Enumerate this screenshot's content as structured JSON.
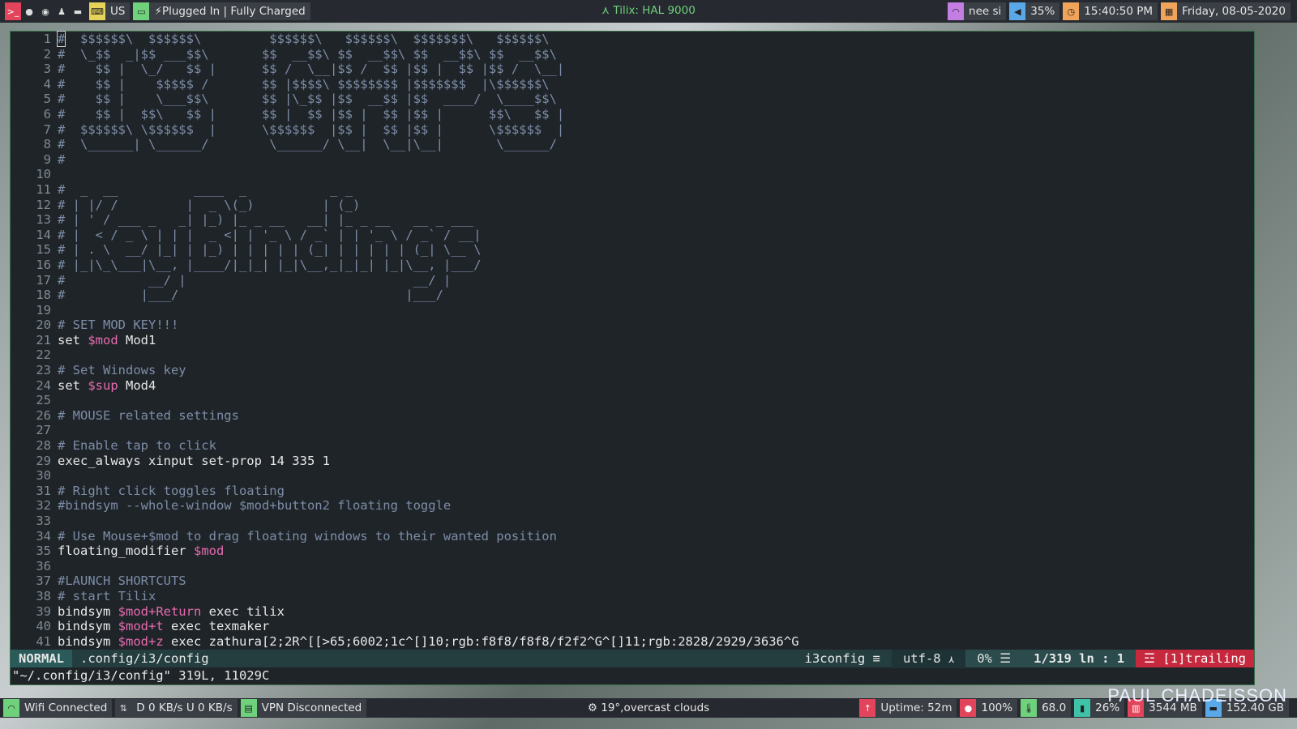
{
  "topbar": {
    "workspace_glyph": ">_",
    "keyboard_layout": "US",
    "battery_status": "Plugged In | Fully Charged",
    "window_title": "Tilix: HAL 9000",
    "wifi_name": "nee si",
    "volume": "35%",
    "time": "15:40:50 PM",
    "date": "Friday, 08-05-2020",
    "colors": {
      "workspace_active": "#e2455b",
      "title": "#6fd17c",
      "wifi": "#c37ee3",
      "volume": "#5aa8e8",
      "clock": "#f0a35a",
      "calendar": "#f0a35a"
    }
  },
  "editor": {
    "lines": [
      {
        "n": "1",
        "t": "#  $$$$$$\\  $$$$$$\\         $$$$$$\\   $$$$$$\\  $$$$$$$\\   $$$$$$\\",
        "k": "cm"
      },
      {
        "n": "2",
        "t": "#  \\_$$  _|$$ ___$$\\       $$  __$$\\ $$  __$$\\ $$  __$$\\ $$  __$$\\",
        "k": "cm"
      },
      {
        "n": "3",
        "t": "#    $$ |  \\_/   $$ |      $$ /  \\__|$$ /  $$ |$$ |  $$ |$$ /  \\__|",
        "k": "cm"
      },
      {
        "n": "4",
        "t": "#    $$ |    $$$$$ /       $$ |$$$$\\ $$$$$$$$ |$$$$$$$  |\\$$$$$$\\",
        "k": "cm"
      },
      {
        "n": "5",
        "t": "#    $$ |    \\___$$\\       $$ |\\_$$ |$$  __$$ |$$  ____/  \\____$$\\",
        "k": "cm"
      },
      {
        "n": "6",
        "t": "#    $$ |  $$\\   $$ |      $$ |  $$ |$$ |  $$ |$$ |      $$\\   $$ |",
        "k": "cm"
      },
      {
        "n": "7",
        "t": "#  $$$$$$\\ \\$$$$$$  |      \\$$$$$$  |$$ |  $$ |$$ |      \\$$$$$$  |",
        "k": "cm"
      },
      {
        "n": "8",
        "t": "#  \\______| \\______/        \\______/ \\__|  \\__|\\__|       \\______/",
        "k": "cm"
      },
      {
        "n": "9",
        "t": "#",
        "k": "cm"
      },
      {
        "n": "10",
        "t": "",
        "k": "cm"
      },
      {
        "n": "11",
        "t": "#  _  __          ____  _           _ _",
        "k": "cm"
      },
      {
        "n": "12",
        "t": "# | |/ /         |  _ \\(_)         | (_)",
        "k": "cm"
      },
      {
        "n": "13",
        "t": "# | ' / ___ _   _| |_) |_ _ __   __| |_ _ __   __ _ ___",
        "k": "cm"
      },
      {
        "n": "14",
        "t": "# |  < / _ \\ | | |  _ <| | '_ \\ / _` | | '_ \\ / _` / __|",
        "k": "cm"
      },
      {
        "n": "15",
        "t": "# | . \\  __/ |_| | |_) | | | | | (_| | | | | | (_| \\__ \\",
        "k": "cm"
      },
      {
        "n": "16",
        "t": "# |_|\\_\\___|\\__, |____/|_|_| |_|\\__,_|_|_| |_|\\__, |___/",
        "k": "cm"
      },
      {
        "n": "17",
        "t": "#           __/ |                              __/ |",
        "k": "cm"
      },
      {
        "n": "18",
        "t": "#          |___/                              |___/",
        "k": "cm"
      },
      {
        "n": "19",
        "t": "",
        "k": "cm"
      },
      {
        "n": "20",
        "t": "# SET MOD KEY!!!",
        "k": "cm"
      },
      {
        "n": "21",
        "a": "set ",
        "v": "$mod",
        "b": " Mod1",
        "k": "code"
      },
      {
        "n": "22",
        "t": "",
        "k": "cm"
      },
      {
        "n": "23",
        "t": "# Set Windows key",
        "k": "cm"
      },
      {
        "n": "24",
        "a": "set ",
        "v": "$sup",
        "b": " Mod4",
        "k": "code"
      },
      {
        "n": "25",
        "t": "",
        "k": "cm"
      },
      {
        "n": "26",
        "t": "# MOUSE related settings",
        "k": "cm"
      },
      {
        "n": "27",
        "t": "",
        "k": "cm"
      },
      {
        "n": "28",
        "t": "# Enable tap to click",
        "k": "cm"
      },
      {
        "n": "29",
        "a": "exec_always xinput set-prop 14 335 1",
        "v": "",
        "b": "",
        "k": "code"
      },
      {
        "n": "30",
        "t": "",
        "k": "cm"
      },
      {
        "n": "31",
        "t": "# Right click toggles floating",
        "k": "cm"
      },
      {
        "n": "32",
        "t": "#bindsym --whole-window $mod+button2 floating toggle",
        "k": "cm"
      },
      {
        "n": "33",
        "t": "",
        "k": "cm"
      },
      {
        "n": "34",
        "t": "# Use Mouse+$mod to drag floating windows to their wanted position",
        "k": "cm"
      },
      {
        "n": "35",
        "a": "floating_modifier ",
        "v": "$mod",
        "b": "",
        "k": "code"
      },
      {
        "n": "36",
        "t": "",
        "k": "cm"
      },
      {
        "n": "37",
        "t": "#LAUNCH SHORTCUTS",
        "k": "cm"
      },
      {
        "n": "38",
        "t": "# start Tilix",
        "k": "cm"
      },
      {
        "n": "39",
        "a": "bindsym ",
        "v": "$mod+Return",
        "b": " exec tilix",
        "k": "code"
      },
      {
        "n": "40",
        "a": "bindsym ",
        "v": "$mod+t",
        "b": " exec texmaker",
        "k": "code"
      },
      {
        "n": "41",
        "a": "bindsym ",
        "v": "$mod+z",
        "b": " exec zathura[2;2R^[[>65;6002;1c^[]10;rgb:f8f8/f8f8/f2f2^G^[]11;rgb:2828/2929/3636^G",
        "k": "code"
      }
    ],
    "status": {
      "mode": "NORMAL",
      "filename": ".config/i3/config",
      "filetype": "i3config",
      "filetype_icon": "≡",
      "encoding": "utf-8",
      "os_icon": "🐧",
      "percent": "0%",
      "percent_icon": "☰",
      "position": "1/319 ln :  1",
      "trailing": "☲ [1]trailing"
    },
    "cmdline": "\"~/.config/i3/config\" 319L, 11029C"
  },
  "bottombar": {
    "wifi": "Wifi Connected",
    "net_speed": "D 0 KB/s U 0 KB/s",
    "vpn": "VPN Disconnected",
    "weather": "19°,overcast clouds",
    "uptime": "Uptime: 52m",
    "brightness": "100%",
    "temperature": "68.0",
    "cpu": "26%",
    "memory": "3544 MB",
    "disk": "152.40 GB",
    "colors": {
      "wifi": "#6fd17c",
      "vpn": "#6fd17c",
      "uptime": "#e2455b",
      "brightness": "#e2455b",
      "temp": "#6fd17c",
      "cpu": "#3fc2a8",
      "mem": "#e2455b",
      "disk": "#5aa8e8"
    }
  },
  "wallpaper_signature": "PAUL CHADEISSON"
}
